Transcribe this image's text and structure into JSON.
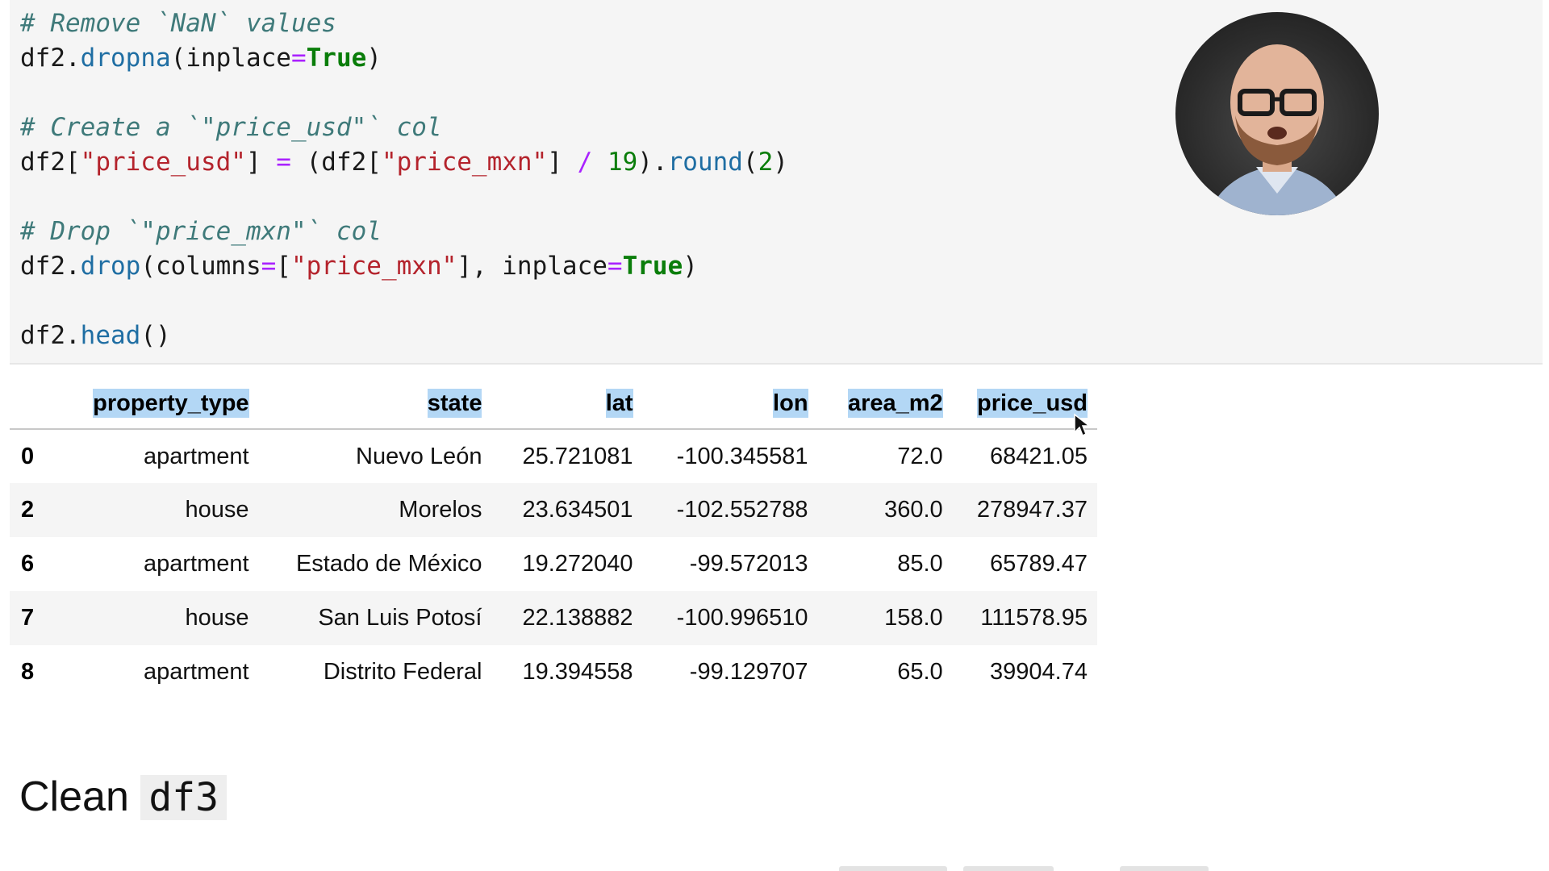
{
  "code_cell": {
    "lines": [
      {
        "comment": "# Remove `NaN` values"
      },
      {
        "obj": "df2",
        "method": "dropna",
        "open": "(inplace",
        "op": "=",
        "kw": "True",
        "close": ")"
      },
      {
        "blank": ""
      },
      {
        "comment": "# Create a `\"price_usd\"` col"
      },
      {
        "p1": "df2[",
        "s1": "\"price_usd\"",
        "p2": "] ",
        "op1": "=",
        "p3": " (df2[",
        "s2": "\"price_mxn\"",
        "p4": "] ",
        "op2": "/",
        "p5": " ",
        "n1": "19",
        "p6": ").",
        "method": "round",
        "p7": "(",
        "n2": "2",
        "p8": ")"
      },
      {
        "blank": ""
      },
      {
        "comment": "# Drop `\"price_mxn\"` col"
      },
      {
        "obj": "df2.",
        "method": "drop",
        "p1": "(columns",
        "op1": "=",
        "p2": "[",
        "s1": "\"price_mxn\"",
        "p3": "], inplace",
        "op2": "=",
        "kw": "True",
        "p4": ")"
      },
      {
        "blank": ""
      },
      {
        "obj": "df2.",
        "method": "head",
        "p1": "()"
      }
    ]
  },
  "table": {
    "columns": [
      "property_type",
      "state",
      "lat",
      "lon",
      "area_m2",
      "price_usd"
    ],
    "rows": [
      {
        "index": "0",
        "property_type": "apartment",
        "state": "Nuevo León",
        "lat": "25.721081",
        "lon": "-100.345581",
        "area_m2": "72.0",
        "price_usd": "68421.05"
      },
      {
        "index": "2",
        "property_type": "house",
        "state": "Morelos",
        "lat": "23.634501",
        "lon": "-102.552788",
        "area_m2": "360.0",
        "price_usd": "278947.37"
      },
      {
        "index": "6",
        "property_type": "apartment",
        "state": "Estado de México",
        "lat": "19.272040",
        "lon": "-99.572013",
        "area_m2": "85.0",
        "price_usd": "65789.47"
      },
      {
        "index": "7",
        "property_type": "house",
        "state": "San Luis Potosí",
        "lat": "22.138882",
        "lon": "-100.996510",
        "area_m2": "158.0",
        "price_usd": "111578.95"
      },
      {
        "index": "8",
        "property_type": "apartment",
        "state": "Distrito Federal",
        "lat": "19.394558",
        "lon": "-99.129707",
        "area_m2": "65.0",
        "price_usd": "39904.74"
      }
    ]
  },
  "markdown": {
    "heading_text": "Clean",
    "heading_code": "df3"
  },
  "colors": {
    "selection_highlight": "#b3d7f5",
    "code_bg": "#f5f5f5"
  }
}
